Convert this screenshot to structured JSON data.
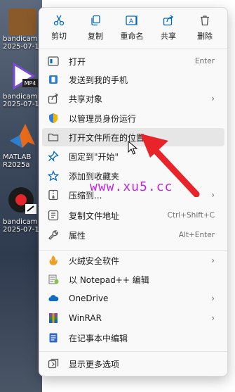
{
  "desktop": {
    "items": [
      {
        "line1": "bandicam",
        "line2": "2025-07-1"
      },
      {
        "line1": "bandicam",
        "line2": "2025-07-1"
      },
      {
        "line1": "MATLAB",
        "line2": "R2025a"
      },
      {
        "line1": "bandicam",
        "line2": "2025-07-1"
      }
    ],
    "mp4_badge": "MP4"
  },
  "quick_actions": [
    {
      "label": "剪切",
      "icon": "scissors-icon"
    },
    {
      "label": "复制",
      "icon": "copy-icon"
    },
    {
      "label": "重命名",
      "icon": "rename-icon"
    },
    {
      "label": "共享",
      "icon": "share-icon"
    },
    {
      "label": "删除",
      "icon": "trash-icon"
    }
  ],
  "menu_items": [
    {
      "label": "打开",
      "shortcut": "Enter",
      "icon": "open-icon"
    },
    {
      "label": "发送到我的手机",
      "shortcut": "",
      "icon": "phone-icon"
    },
    {
      "label": "共享对象",
      "shortcut": "",
      "icon": "share-object-icon"
    },
    {
      "label": "以管理员身份运行",
      "shortcut": "",
      "icon": "shield-icon"
    },
    {
      "label": "打开文件所在的位置",
      "shortcut": "",
      "icon": "folder-icon"
    },
    {
      "label": "固定到\"开始\"",
      "shortcut": "",
      "icon": "pin-icon"
    },
    {
      "label": "添加到收藏夹",
      "shortcut": "",
      "icon": "star-icon"
    },
    {
      "label": "压缩到...",
      "shortcut": "",
      "icon": "zip-icon"
    },
    {
      "label": "复制文件地址",
      "shortcut": "Ctrl+Shift+C",
      "icon": "copy-path-icon"
    },
    {
      "label": "属性",
      "shortcut": "Alt+Enter",
      "icon": "wrench-icon"
    },
    {
      "label": "火绒安全软件",
      "shortcut": "",
      "icon": "huorong-icon"
    },
    {
      "label": "以 Notepad++ 编辑",
      "shortcut": "",
      "icon": "notepad-plus-icon"
    },
    {
      "label": "OneDrive",
      "shortcut": "",
      "icon": "onedrive-icon"
    },
    {
      "label": "WinRAR",
      "shortcut": "",
      "icon": "winrar-icon"
    },
    {
      "label": "在记事本中编辑",
      "shortcut": "",
      "icon": "notepad-icon"
    },
    {
      "label": "显示更多选项",
      "shortcut": "",
      "icon": "more-options-icon"
    }
  ],
  "watermark": "www.xu5.cc",
  "colors": {
    "accent": "#0067c0",
    "arrow": "#e8242a",
    "watermark": "#c126e0",
    "menu_bg": "#f9f9f9",
    "hover_bg": "#e6e6e6"
  }
}
